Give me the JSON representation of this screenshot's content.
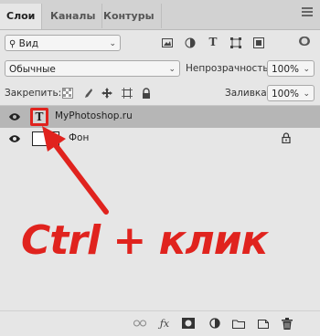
{
  "tabs": [
    {
      "label": "Слои",
      "active": true
    },
    {
      "label": "Каналы",
      "active": false
    },
    {
      "label": "Контуры",
      "active": false
    }
  ],
  "filter": {
    "label": "Вид"
  },
  "blend": {
    "mode": "Обычные",
    "opacity_label": "Непрозрачность:",
    "opacity_value": "100%"
  },
  "lock": {
    "label": "Закрепить:",
    "fill_label": "Заливка:",
    "fill_value": "100%"
  },
  "layers": [
    {
      "name": "MyPhotoshop.ru",
      "type": "text",
      "thumb": "T",
      "selected": true
    },
    {
      "name": "Фон",
      "type": "background",
      "selected": false
    }
  ],
  "annotation": {
    "text": "Ctrl + клик",
    "color": "#e0231e"
  },
  "colors": {
    "accent": "#e0231e",
    "panel": "#e6e6e6",
    "selected_row": "#b6b6b6"
  }
}
